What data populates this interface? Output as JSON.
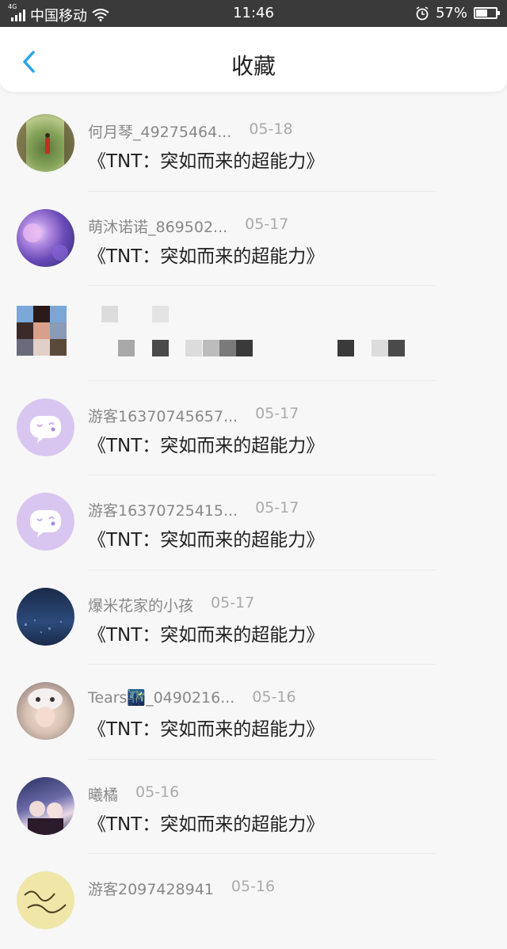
{
  "status_bar": {
    "network": "4G",
    "carrier": "中国移动",
    "time": "11:46",
    "battery_percent": "57%",
    "battery_level": 0.57
  },
  "header": {
    "back_icon": "chevron-left-icon",
    "title": "收藏"
  },
  "colors": {
    "accent": "#2aa4e8",
    "placeholder_avatar": "#d9c6f0"
  },
  "items": [
    {
      "user": "何月琴_49275464...",
      "date": "05-18",
      "work": "《TNT：突如而来的超能力》"
    },
    {
      "user": "萌沐诺诺_869502...",
      "date": "05-17",
      "work": "《TNT：突如而来的超能力》"
    },
    {
      "user": "",
      "date": "",
      "work": ""
    },
    {
      "user": "游客16370745657...",
      "date": "05-17",
      "work": "《TNT：突如而来的超能力》"
    },
    {
      "user": "游客16370725415...",
      "date": "05-17",
      "work": "《TNT：突如而来的超能力》"
    },
    {
      "user": "爆米花家的小孩",
      "date": "05-17",
      "work": "《TNT：突如而来的超能力》"
    },
    {
      "user": "Tears🌃_0490216...",
      "date": "05-16",
      "work": "《TNT：突如而来的超能力》"
    },
    {
      "user": "曦橘",
      "date": "05-16",
      "work": "《TNT：突如而来的超能力》"
    },
    {
      "user": "游客2097428941",
      "date": "05-16",
      "work": ""
    }
  ]
}
